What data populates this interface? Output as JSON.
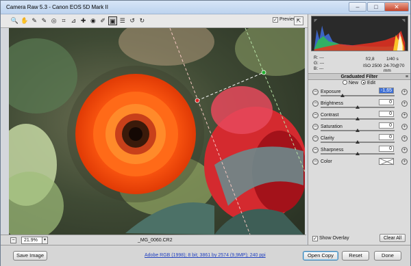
{
  "window": {
    "title": "Camera Raw 5.3  -  Canon EOS 5D Mark II",
    "minimize": "–",
    "maximize": "□",
    "close": "✕"
  },
  "toolbar": {
    "tools": [
      {
        "name": "zoom-tool-icon",
        "glyph": "🔍"
      },
      {
        "name": "hand-tool-icon",
        "glyph": "✋"
      },
      {
        "name": "white-balance-tool-icon",
        "glyph": "✎"
      },
      {
        "name": "color-sampler-tool-icon",
        "glyph": "✎"
      },
      {
        "name": "targeted-adjustment-tool-icon",
        "glyph": "◎"
      },
      {
        "name": "crop-tool-icon",
        "glyph": "⌗"
      },
      {
        "name": "straighten-tool-icon",
        "glyph": "⊿"
      },
      {
        "name": "spot-removal-tool-icon",
        "glyph": "✚"
      },
      {
        "name": "red-eye-tool-icon",
        "glyph": "◉"
      },
      {
        "name": "adjustment-brush-icon",
        "glyph": "✐"
      },
      {
        "name": "graduated-filter-icon",
        "glyph": "▣"
      },
      {
        "name": "preferences-icon",
        "glyph": "☰"
      },
      {
        "name": "rotate-left-icon",
        "glyph": "↺"
      },
      {
        "name": "rotate-right-icon",
        "glyph": "↻"
      }
    ],
    "preview_label": "Preview",
    "preview_checked": "✓"
  },
  "image": {
    "zoom": "21.9%",
    "filename": "_MG_0060.CR2"
  },
  "info": {
    "r": "R:  ---",
    "g": "G:  ---",
    "b": "B:  ---",
    "aperture": "f/2,8",
    "shutter": "1/40 s",
    "iso": "ISO 2500",
    "lens": "24-70@70 mm"
  },
  "panel": {
    "title": "Graduated Filter",
    "menu_icon": "≡",
    "mode_new": "New",
    "mode_edit": "Edit",
    "sliders": [
      {
        "label": "Exposure",
        "value": "-1,65",
        "pos": 0.3,
        "selected": true
      },
      {
        "label": "Brightness",
        "value": "0",
        "pos": 0.5
      },
      {
        "label": "Contrast",
        "value": "0",
        "pos": 0.5
      },
      {
        "label": "Saturation",
        "value": "0",
        "pos": 0.5
      },
      {
        "label": "Clarity",
        "value": "0",
        "pos": 0.5
      },
      {
        "label": "Sharpness",
        "value": "0",
        "pos": 0.5
      }
    ],
    "color_label": "Color",
    "show_overlay": "Show Overlay",
    "clear_all": "Clear All"
  },
  "bottom": {
    "save": "Save Image",
    "workflow": "Adobe RGB (1998); 8 bit; 3861 by 2574 (9,9MP); 240 ppi",
    "open": "Open Copy",
    "reset": "Reset",
    "done": "Done"
  }
}
